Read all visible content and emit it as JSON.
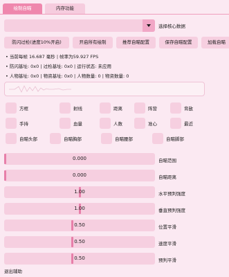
{
  "tabs": [
    {
      "label": "绘制自瞄",
      "active": true
    },
    {
      "label": "内存功能",
      "active": false
    }
  ],
  "core_select": {
    "value": "",
    "label": "选择核心数据"
  },
  "buttons": [
    "防闪过检(进度10%开启)",
    "开启所有绘制",
    "推荐自瞄配置",
    "保存自瞄配置",
    "加载自瞄"
  ],
  "info": {
    "line1": "当前每帧 16.687 毫秒 | 帧率为59.927 FPS",
    "line2": "防闪基址: 0x0 | 过检基址: 0x0 | 运行状态: 未应用",
    "line3": "人物基址: 0x0 | 物资基址: 0x0 | 人物数量: 0 | 物资数量: 0"
  },
  "checkboxes": {
    "row1": [
      "方框",
      "射线",
      "距离",
      "阵营",
      "背敌"
    ],
    "row2": [
      "手持",
      "血量",
      "人数",
      "准心",
      "最近"
    ],
    "row3": [
      "自瞄头部",
      "自瞄胸部",
      "自瞄腰部",
      "自瞄脚部"
    ]
  },
  "sliders": [
    {
      "value": "0.000",
      "label": "自瞄范围",
      "level": 0.0
    },
    {
      "value": "0.000",
      "label": "自瞄距离",
      "level": 0.0
    },
    {
      "value": "1.00",
      "label": "水平预判强度",
      "level": 0.5
    },
    {
      "value": "1.00",
      "label": "垂直预判强度",
      "level": 0.5
    },
    {
      "value": "0.50",
      "label": "位置平滑",
      "level": 0.45
    },
    {
      "value": "0.50",
      "label": "速度平滑",
      "level": 0.45
    },
    {
      "value": "0.50",
      "label": "预判平滑",
      "level": 0.45
    }
  ],
  "exit_label": "退出辅助",
  "colors": {
    "accent": "#ef87ad",
    "widget": "#f6cfe0",
    "background": "#fbe9f2"
  }
}
